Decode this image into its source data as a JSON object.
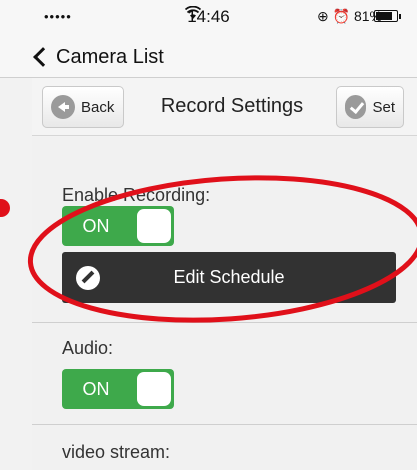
{
  "status_bar": {
    "signal": "•••••",
    "wifi_icon": "wifi-icon",
    "time": "14:46",
    "right": "⊕ ⏰ 81%",
    "battery_level": 0.81
  },
  "nav": {
    "back_label": "Camera List"
  },
  "toolbar": {
    "back_label": "Back",
    "title": "Record Settings",
    "set_label": "Set"
  },
  "settings": {
    "enable_recording_label": "Enable Recording:",
    "enable_recording_state": "ON",
    "edit_schedule_label": "Edit Schedule",
    "audio_label": "Audio:",
    "audio_state": "ON",
    "video_stream_label": "video stream:"
  },
  "annotation": {
    "color": "#e0101a"
  }
}
